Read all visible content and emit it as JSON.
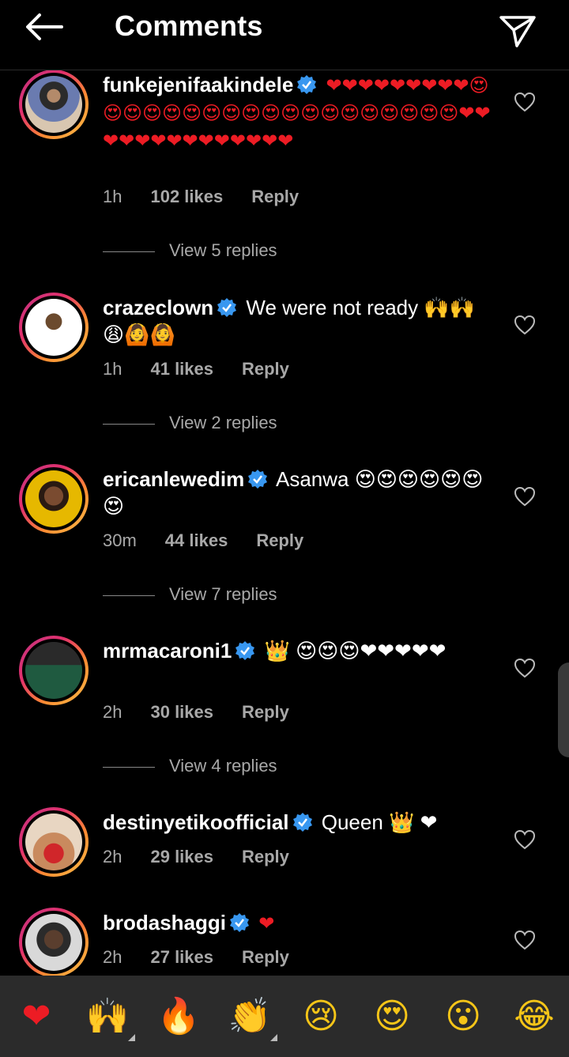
{
  "header": {
    "title": "Comments"
  },
  "comments": [
    {
      "username": "funkejenifaakindele",
      "body": "❤❤❤❤❤❤❤❤❤😍😍😍😍😍😍😍😍😍😍😍😍😍😍😍😍😍😍😍❤❤❤❤❤❤❤❤❤❤❤❤❤❤",
      "time": "1h",
      "likes": "102 likes",
      "reply": "Reply",
      "view_replies": "View 5 replies"
    },
    {
      "username": "crazeclown",
      "body": "We were not ready 🙌🙌😩🙆🙆",
      "time": "1h",
      "likes": "41 likes",
      "reply": "Reply",
      "view_replies": "View 2 replies"
    },
    {
      "username": "ericanlewedim",
      "body": "Asanwa 😍😍😍😍😍😍😍",
      "time": "30m",
      "likes": "44 likes",
      "reply": "Reply",
      "view_replies": "View 7 replies"
    },
    {
      "username": "mrmacaroni1",
      "body": "👑 😍😍😍❤❤❤❤❤",
      "time": "2h",
      "likes": "30 likes",
      "reply": "Reply",
      "view_replies": "View 4 replies"
    },
    {
      "username": "destinyetikoofficial",
      "body": "Queen 👑 ❤",
      "time": "2h",
      "likes": "29 likes",
      "reply": "Reply"
    },
    {
      "username": "brodashaggi",
      "body": "❤",
      "time": "2h",
      "likes": "27 likes",
      "reply": "Reply"
    }
  ],
  "emoji_bar": [
    "❤",
    "🙌",
    "🔥",
    "👏",
    "😢",
    "😍",
    "😮",
    "😂"
  ],
  "colors": {
    "background": "#000000",
    "verified": "#3897f0",
    "heart": "#ed1c24",
    "muted": "#a8a8a8"
  }
}
